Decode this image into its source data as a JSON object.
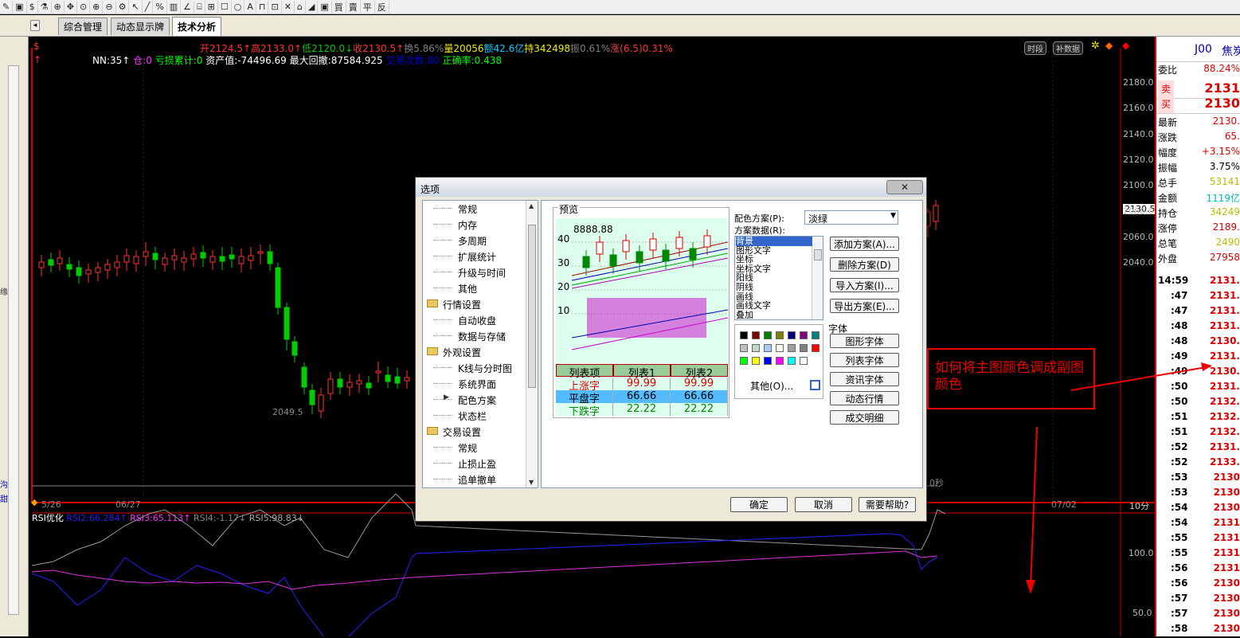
{
  "toolbar": {
    "items": [
      "✎",
      "▣",
      "$",
      "⚗",
      "⊕",
      "✥",
      "⊙",
      "⊕",
      "⊖",
      "⚙",
      "↖",
      "╱",
      "%",
      "▥",
      "∠",
      "⌸",
      "⊞",
      "☐",
      "○",
      "A",
      "⊓",
      "⊡",
      "✕",
      "⌂",
      "◢",
      "▣",
      "買",
      "賣",
      "平",
      "反"
    ]
  },
  "tabs": [
    {
      "label": "综合管理"
    },
    {
      "label": "动态显示牌"
    },
    {
      "label": "技术分析"
    }
  ],
  "info_line1": {
    "s_icon": "$",
    "open": "开2124.5↑",
    "high": "高2133.0↑",
    "low": "低2120.0↓",
    "close": "收2130.5↑",
    "turnover_rate": "换5.86%",
    "volume": "量20056",
    "amount": "额42.6亿",
    "position": "持342498",
    "amplitude": "振0.61%",
    "change": "涨(6.5)0.31%"
  },
  "info_line2": {
    "nn": "NN:35↑",
    "cang": "仓:0",
    "loss_acc": "亏损累计:0",
    "assets": "资产值:-74496.69",
    "max_drawdown": "最大回撤:87584.925",
    "trades_label": "交易次数:80",
    "accuracy": "正确率:0.438"
  },
  "chart_buttons": {
    "period": "时段",
    "supplement": "补数据"
  },
  "price_axis": [
    "2180.0",
    "2160.0",
    "2140.0",
    "2120.0",
    "2100.0",
    "2080.0",
    "2060.0",
    "2040.0"
  ],
  "price_tag": "2130.5",
  "low_label": "2049.5",
  "seconds_label": "0秒",
  "date_labels": [
    "5/26",
    "06/27",
    "07/02"
  ],
  "timeframe": "10分",
  "rsi": {
    "title": "RSI优化",
    "rsi2": "RSI2:66.284↑",
    "rsi3": "RSI3:65.113↑",
    "rsi4": "RSI4:-1.17↓",
    "rsi5": "RSI5:98.83↓",
    "axis": [
      "100.0",
      "50.0"
    ]
  },
  "left_strip": {
    "labels": [
      "缘",
      "沟",
      "甜"
    ]
  },
  "quote": {
    "symbol": "J00",
    "name": "焦炭",
    "rows": [
      {
        "k": "委比",
        "v": "88.24%",
        "c": "#d00"
      },
      {
        "k": "卖",
        "v": "2131",
        "c": "#d00"
      },
      {
        "k": "买",
        "v": "2130",
        "c": "#d00"
      },
      {
        "k": "最新",
        "v": "2130.",
        "c": "#d00"
      },
      {
        "k": "涨跌",
        "v": "65.",
        "c": "#d00"
      },
      {
        "k": "幅度",
        "v": "+3.15%",
        "c": "#d00"
      },
      {
        "k": "振幅",
        "v": "3.75%",
        "c": "#000"
      },
      {
        "k": "总手",
        "v": "53141",
        "c": "#bb0"
      },
      {
        "k": "金额",
        "v": "1119亿",
        "c": "#0bb"
      },
      {
        "k": "持仓",
        "v": "34249",
        "c": "#bb0"
      },
      {
        "k": "涨停",
        "v": "2189.",
        "c": "#d00"
      },
      {
        "k": "总笔",
        "v": "2490",
        "c": "#bb0"
      },
      {
        "k": "外盘",
        "v": "27958",
        "c": "#d00"
      }
    ],
    "ticks": [
      {
        "t": "14:59",
        "p": "2131."
      },
      {
        "t": ":47",
        "p": "2131."
      },
      {
        "t": ":47",
        "p": "2131."
      },
      {
        "t": ":48",
        "p": "2131."
      },
      {
        "t": ":48",
        "p": "2130."
      },
      {
        "t": ":49",
        "p": "2131."
      },
      {
        "t": ":49",
        "p": "2130."
      },
      {
        "t": ":50",
        "p": "2131."
      },
      {
        "t": ":50",
        "p": "2132."
      },
      {
        "t": ":51",
        "p": "2132."
      },
      {
        "t": ":51",
        "p": "2132."
      },
      {
        "t": ":52",
        "p": "2131."
      },
      {
        "t": ":52",
        "p": "2133."
      },
      {
        "t": ":53",
        "p": "2130"
      },
      {
        "t": ":53",
        "p": "2130"
      },
      {
        "t": ":54",
        "p": "2130"
      },
      {
        "t": ":54",
        "p": "2131"
      },
      {
        "t": ":55",
        "p": "2131"
      },
      {
        "t": ":55",
        "p": "2131"
      },
      {
        "t": ":56",
        "p": "2131"
      },
      {
        "t": ":56",
        "p": "2130"
      },
      {
        "t": ":57",
        "p": "2130"
      },
      {
        "t": ":57",
        "p": "2130"
      },
      {
        "t": ":58",
        "p": "2130"
      }
    ]
  },
  "dialog": {
    "title": "选项",
    "close": "✕",
    "tree": [
      {
        "label": "常规",
        "level": 2
      },
      {
        "label": "内存",
        "level": 2
      },
      {
        "label": "多周期",
        "level": 2
      },
      {
        "label": "扩展统计",
        "level": 2
      },
      {
        "label": "升级与时间",
        "level": 2
      },
      {
        "label": "其他",
        "level": 2
      },
      {
        "label": "行情设置",
        "level": 1
      },
      {
        "label": "自动收盘",
        "level": 2
      },
      {
        "label": "数据与存储",
        "level": 2
      },
      {
        "label": "外观设置",
        "level": 1
      },
      {
        "label": "K线与分时图",
        "level": 2
      },
      {
        "label": "系统界面",
        "level": 2
      },
      {
        "label": "配色方案",
        "level": 2
      },
      {
        "label": "状态栏",
        "level": 2
      },
      {
        "label": "交易设置",
        "level": 1
      },
      {
        "label": "常规",
        "level": 2
      },
      {
        "label": "止损止盈",
        "level": 2
      },
      {
        "label": "追单撤单",
        "level": 2
      }
    ],
    "preview": {
      "title": "预览",
      "value": "8888.88",
      "yaxis": [
        "40",
        "30",
        "20",
        "10"
      ],
      "table_headers": [
        "列表项",
        "列表1",
        "列表2"
      ],
      "table_rows": [
        [
          "上涨字",
          "99.99",
          "99.99"
        ],
        [
          "平盘字",
          "66.66",
          "66.66"
        ],
        [
          "下跌字",
          "22.22",
          "22.22"
        ]
      ]
    },
    "scheme_label": "配色方案(P):",
    "scheme_value": "淡绿",
    "scheme_data_label": "方案数据(R):",
    "scheme_items": [
      "背景",
      "图形文字",
      "坐标",
      "坐标文字",
      "阳线",
      "阴线",
      "画线",
      "画线文字",
      "叠加"
    ],
    "buttons": {
      "add": "添加方案(A)...",
      "delete": "删除方案(D)",
      "import": "导入方案(I)...",
      "export": "导出方案(E)..."
    },
    "font_label": "字体",
    "font_buttons": [
      "图形字体",
      "列表字体",
      "资讯字体",
      "动态行情",
      "成交明细"
    ],
    "swatches": [
      "#000000",
      "#800000",
      "#008000",
      "#808000",
      "#000080",
      "#800080",
      "#008080",
      "#c0c0c0",
      "#c0dcc0",
      "#a6caf0",
      "#fffbf0",
      "#a0a0a4",
      "#808080",
      "#ff0000",
      "#00ff00",
      "#ffff00",
      "#0000ff",
      "#ff00ff",
      "#00ffff",
      "#ffffff"
    ],
    "other": "其他(O)...",
    "ok": "确定",
    "cancel": "取消",
    "help": "需要帮助?"
  },
  "annotation": {
    "text": "如何将主图颜色调成副图颜色"
  }
}
